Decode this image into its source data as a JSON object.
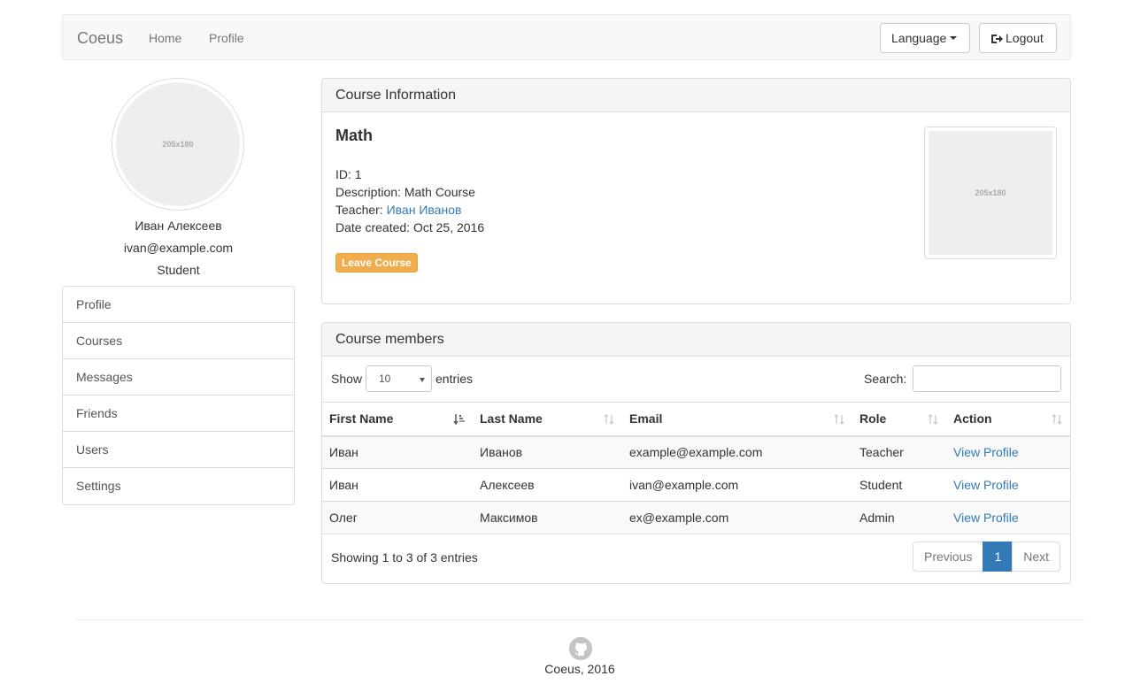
{
  "navbar": {
    "brand": "Coeus",
    "links": [
      "Home",
      "Profile"
    ],
    "language_label": "Language",
    "logout_label": "Logout"
  },
  "sidebar": {
    "avatar_placeholder": "205x180",
    "name": "Иван Алексеев",
    "email": "ivan@example.com",
    "role": "Student",
    "items": [
      {
        "label": "Profile"
      },
      {
        "label": "Courses"
      },
      {
        "label": "Messages"
      },
      {
        "label": "Friends"
      },
      {
        "label": "Users"
      },
      {
        "label": "Settings"
      }
    ]
  },
  "course": {
    "heading": "Course Information",
    "title": "Math",
    "id_label": "ID:",
    "id_value": "1",
    "description_label": "Description:",
    "description_value": "Math Course",
    "teacher_label": "Teacher:",
    "teacher_value": "Иван Иванов",
    "date_label": "Date created:",
    "date_value": "Oct 25, 2016",
    "leave_button": "Leave Course",
    "image_placeholder": "205x180"
  },
  "members": {
    "heading": "Course members",
    "show_label": "Show",
    "entries_label": "entries",
    "page_length": "10",
    "search_label": "Search:",
    "search_value": "",
    "columns": [
      "First Name",
      "Last Name",
      "Email",
      "Role",
      "Action"
    ],
    "rows": [
      {
        "first": "Иван",
        "last": "Иванов",
        "email": "example@example.com",
        "role": "Teacher",
        "action": "View Profile"
      },
      {
        "first": "Иван",
        "last": "Алексеев",
        "email": "ivan@example.com",
        "role": "Student",
        "action": "View Profile"
      },
      {
        "first": "Олег",
        "last": "Максимов",
        "email": "ex@example.com",
        "role": "Admin",
        "action": "View Profile"
      }
    ],
    "info": "Showing 1 to 3 of 3 entries",
    "pagination": {
      "previous": "Previous",
      "current": "1",
      "next": "Next"
    }
  },
  "footer": {
    "text": "Coeus, 2016",
    "icon": "github-icon"
  }
}
